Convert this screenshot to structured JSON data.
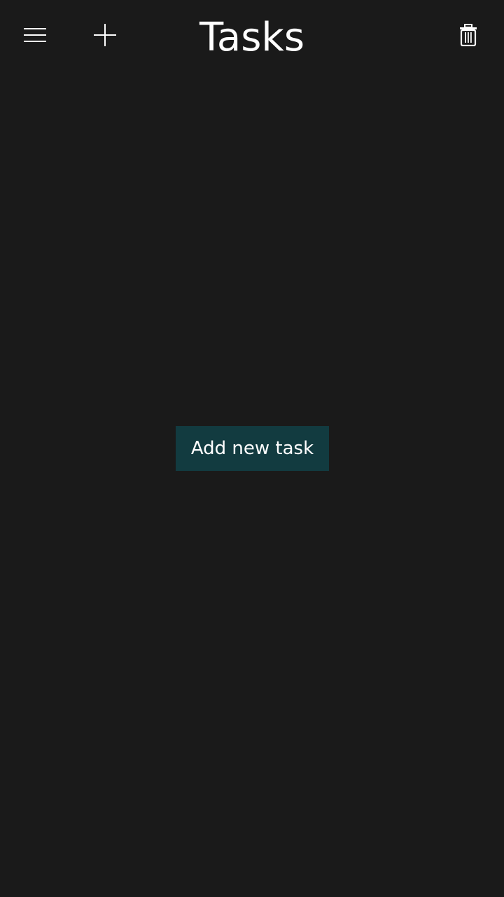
{
  "app": {
    "title": "Tasks"
  },
  "toolbar": {
    "menu_icon": "hamburger-menu-icon",
    "add_icon": "plus-icon",
    "delete_icon": "trash-icon"
  },
  "main": {
    "add_task_label": "Add new task"
  },
  "colors": {
    "background": "#1a1a1a",
    "button_background": "#123b40",
    "foreground": "#ffffff"
  }
}
